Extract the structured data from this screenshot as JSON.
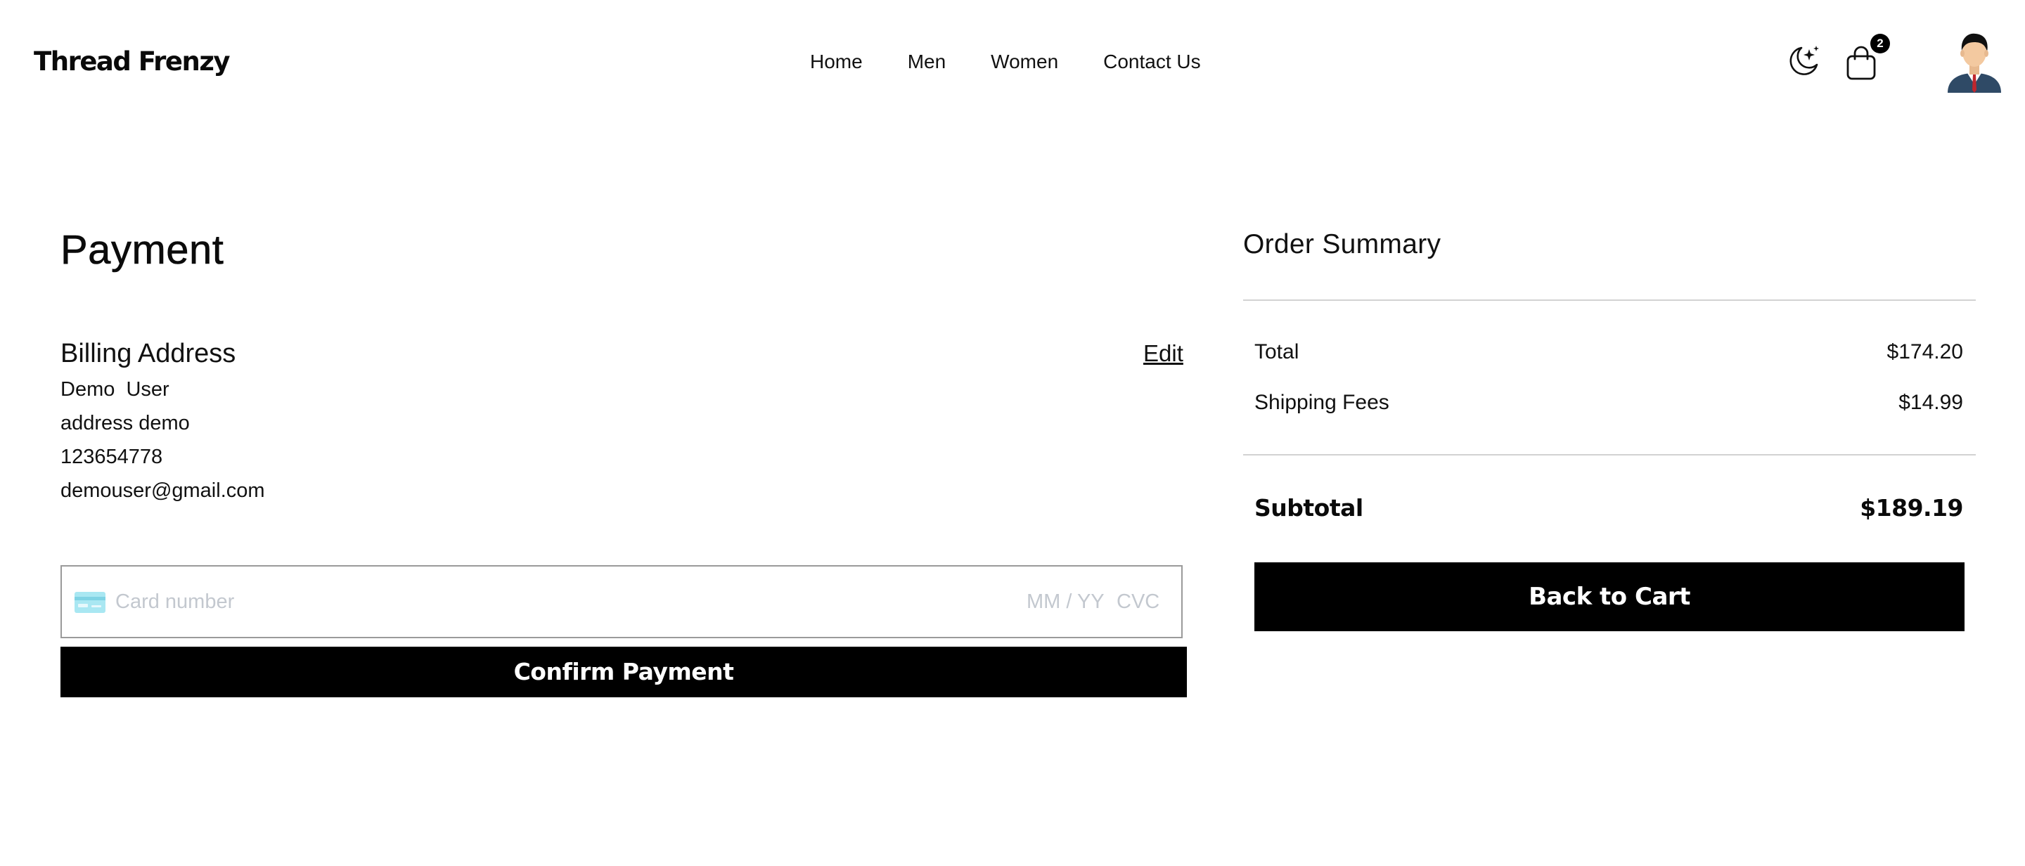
{
  "header": {
    "brand": "Thread Frenzy",
    "nav": [
      {
        "label": "Home"
      },
      {
        "label": "Men"
      },
      {
        "label": "Women"
      },
      {
        "label": "Contact Us"
      }
    ],
    "theme_icon": "moon-stars-icon",
    "cart_icon": "shopping-bag-icon",
    "cart_count": "2",
    "avatar_icon": "user-avatar-icon"
  },
  "payment": {
    "title": "Payment",
    "billing": {
      "heading": "Billing Address",
      "edit_label": "Edit",
      "name": "Demo  User",
      "address": "address demo",
      "phone": "123654778",
      "email": "demouser@gmail.com"
    },
    "card": {
      "icon": "credit-card-icon",
      "number_placeholder": "Card number",
      "expiry_placeholder": "MM / YY",
      "cvc_placeholder": "CVC"
    },
    "confirm_label": "Confirm Payment"
  },
  "summary": {
    "title": "Order Summary",
    "rows": [
      {
        "label": "Total",
        "value": "$174.20"
      },
      {
        "label": "Shipping Fees",
        "value": "$14.99"
      }
    ],
    "subtotal_label": "Subtotal",
    "subtotal_value": "$189.19",
    "back_label": "Back to Cart"
  },
  "colors": {
    "primary": "#000000",
    "background": "#ffffff",
    "divider": "#d2d2d2",
    "placeholder": "#c3c8cf",
    "card_icon": "#a9e7f2"
  }
}
